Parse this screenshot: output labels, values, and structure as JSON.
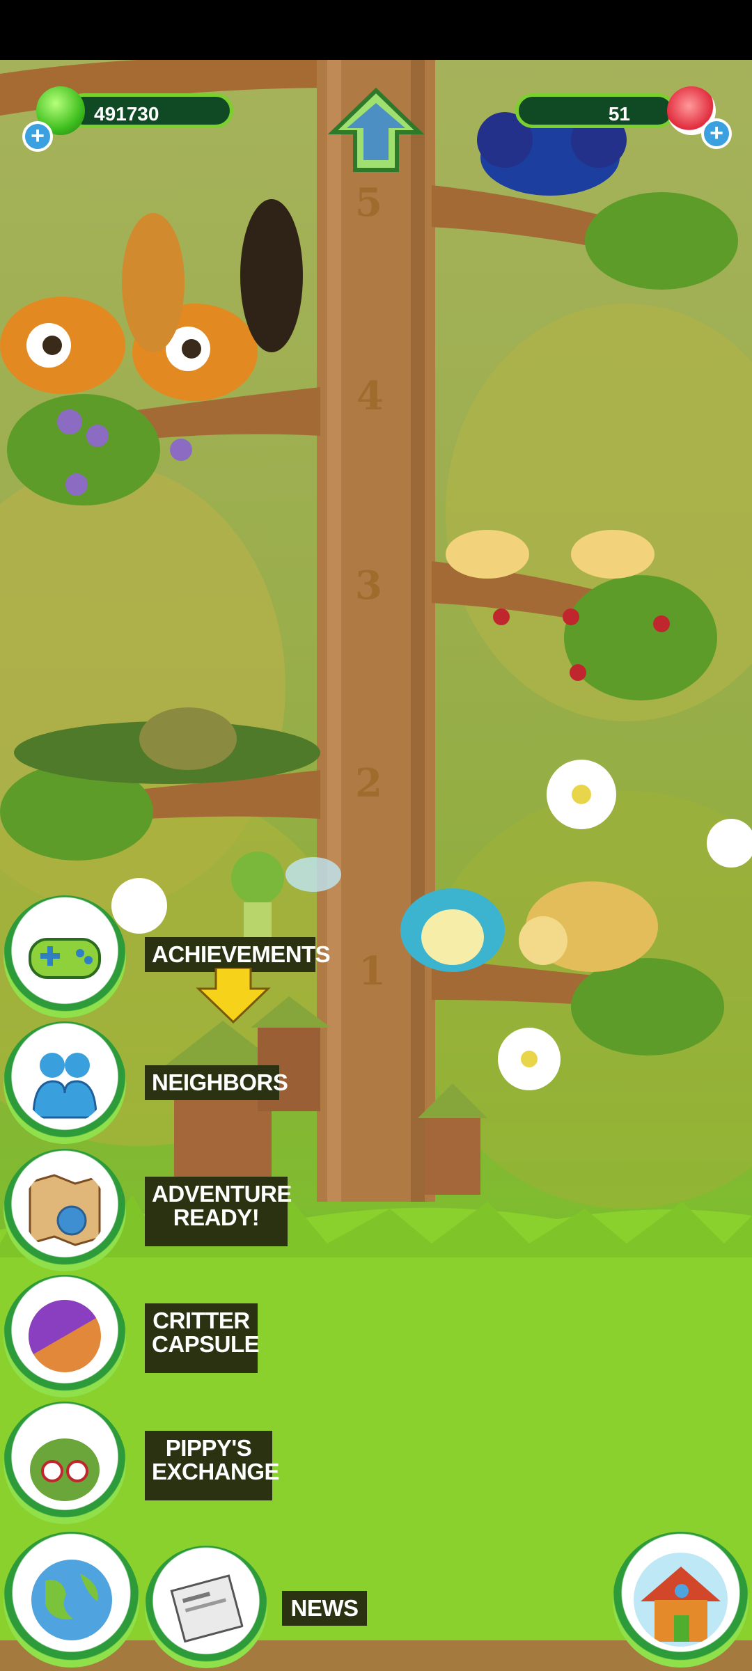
{
  "hud": {
    "currency_left": "491730",
    "currency_right": "51",
    "plus_left": "+",
    "plus_right": "+"
  },
  "tree_levels": [
    "5",
    "4",
    "3",
    "2",
    "1"
  ],
  "menu": {
    "achievements": "ACHIEVEMENTS",
    "neighbors": "NEIGHBORS",
    "adventure_line1": "ADVENTURE",
    "adventure_line2": "READY!",
    "capsule_line1": "CRITTER",
    "capsule_line2": "CAPSULE",
    "exchange_line1": "PIPPY'S",
    "exchange_line2": "EXCHANGE",
    "news": "NEWS"
  },
  "icons": [
    "gamepad-icon",
    "neighbors-icon",
    "map-icon",
    "capsule-icon",
    "pippy-icon",
    "globe-icon",
    "newspaper-icon",
    "house-icon",
    "up-arrow-icon",
    "green-gem-icon",
    "red-gem-icon"
  ],
  "colors": {
    "hud_bar": "#0f4a25",
    "hud_border": "#7bcf2e",
    "label_bg": "#2b3212",
    "grass": "#8fd133"
  }
}
